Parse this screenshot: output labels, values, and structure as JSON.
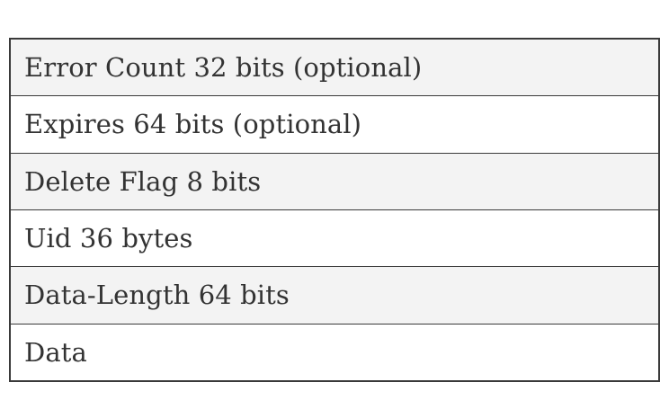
{
  "rows": [
    {
      "label": "Error Count 32 bits (optional)"
    },
    {
      "label": "Expires 64 bits (optional)"
    },
    {
      "label": "Delete Flag 8 bits"
    },
    {
      "label": "Uid 36 bytes"
    },
    {
      "label": "Data-Length 64 bits"
    },
    {
      "label": "Data"
    }
  ],
  "colors": {
    "shaded_row": "#f3f3f3",
    "plain_row": "#ffffff",
    "border": "#3a3a3a",
    "text": "#333333"
  }
}
